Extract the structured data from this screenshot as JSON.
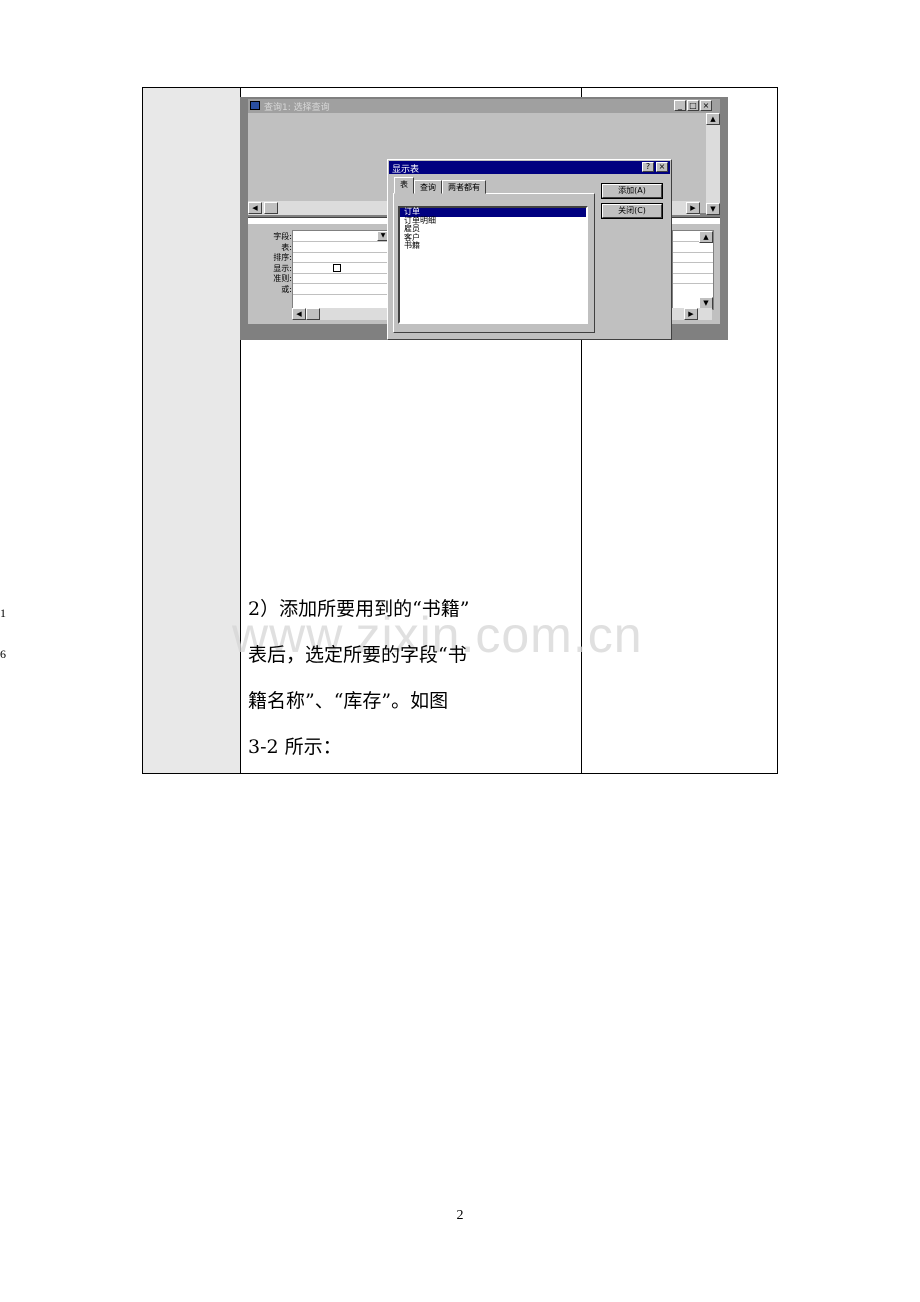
{
  "margin_numbers": [
    "1",
    "6"
  ],
  "screenshot": {
    "query_window": {
      "title": "查询1: 选择查询",
      "row_labels": [
        "字段:",
        "表:",
        "排序:",
        "显示:",
        "准则:",
        "或:"
      ],
      "buttons": {
        "minimize": "_",
        "maximize": "□",
        "close": "×"
      }
    },
    "dialog": {
      "title": "显示表",
      "help_btn": "?",
      "close_btn": "×",
      "tabs": [
        "表",
        "查询",
        "两者都有"
      ],
      "items": [
        "订单",
        "订单明细",
        "雇员",
        "客户",
        "书籍"
      ],
      "selected_index": 0,
      "add_button": "添加(A)",
      "close_button": "关闭(C)"
    }
  },
  "paragraph_lines": [
    "2）添加所要用到的“书籍”",
    "表后，选定所要的字段“书",
    "籍名称”、“库存”。如图",
    "3-2 所示："
  ],
  "watermark": "www.zixin.com.cn",
  "page_number": "2"
}
